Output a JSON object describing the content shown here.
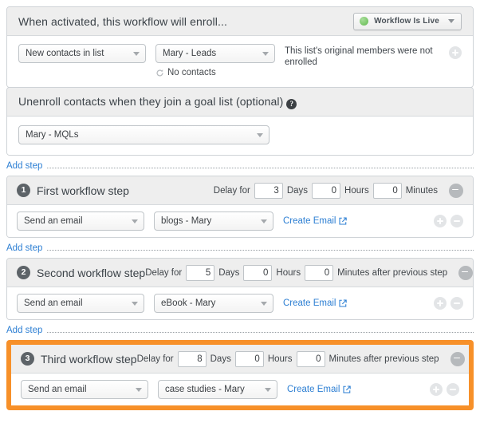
{
  "enroll": {
    "title": "When activated, this workflow will enroll...",
    "status_button": {
      "label": "Workflow Is Live",
      "dot_color": "#7ec96d",
      "caret_icon": "chevron-down-icon"
    },
    "trigger_type": "New contacts in list",
    "trigger_list": "Mary - Leads",
    "contacts_status": "No contacts",
    "contacts_status_icon": "refresh-icon",
    "note": "This list's original members were not enrolled",
    "add_icon": "plus-circle-icon"
  },
  "goal": {
    "title": "Unenroll contacts when they join a goal list (optional)",
    "help_icon": "help-circle-icon",
    "help_glyph": "?",
    "list": "Mary - MQLs"
  },
  "add_step_label": "Add step",
  "labels": {
    "delay_for": "Delay for",
    "days": "Days",
    "hours": "Hours",
    "minutes": "Minutes",
    "minutes_after": "Minutes after previous step",
    "create_email": "Create Email"
  },
  "highlight_color": "#f79029",
  "link_color": "#2d7fd3",
  "steps": [
    {
      "number": "1",
      "name": "First workflow step",
      "delay_days": "3",
      "delay_hours": "0",
      "delay_minutes": "0",
      "minutes_suffix": "Minutes",
      "action": "Send an email",
      "email": "blogs - Mary",
      "create_email": "Create Email",
      "highlighted": false
    },
    {
      "number": "2",
      "name": "Second workflow step",
      "delay_days": "5",
      "delay_hours": "0",
      "delay_minutes": "0",
      "minutes_suffix": "Minutes after previous step",
      "action": "Send an email",
      "email": "eBook - Mary",
      "create_email": "Create Email",
      "highlighted": false
    },
    {
      "number": "3",
      "name": "Third workflow step",
      "delay_days": "8",
      "delay_hours": "0",
      "delay_minutes": "0",
      "minutes_suffix": "Minutes after previous step",
      "action": "Send an email",
      "email": "case studies - Mary",
      "create_email": "Create Email",
      "highlighted": true
    }
  ]
}
